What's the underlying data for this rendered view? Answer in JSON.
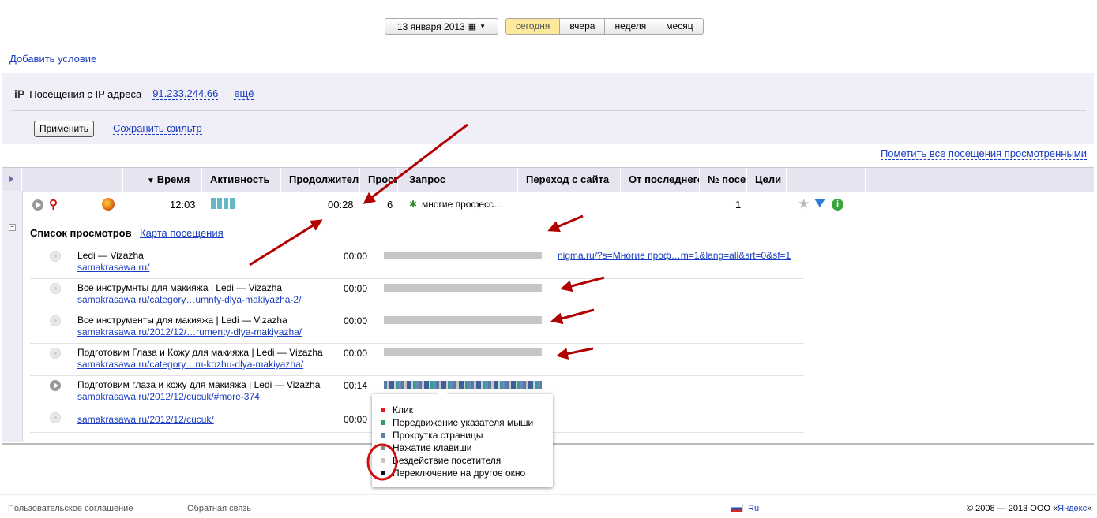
{
  "date_picker": {
    "label": "13 января 2013",
    "icon": "calendar-icon"
  },
  "periods": [
    "сегодня",
    "вчера",
    "неделя",
    "месяц"
  ],
  "add_condition": "Добавить условие",
  "filter": {
    "ip_icon": "iP",
    "label": "Посещения с IP адреса",
    "ip": "91.233.244.66",
    "more": "ещё",
    "apply": "Применить",
    "save": "Сохранить фильтр"
  },
  "mark_all": "Пометить все посещения просмотренными",
  "columns": [
    "Время",
    "Активность",
    "Продолжительность",
    "Просмотры",
    "Запрос",
    "Переход с сайта",
    "От последнего",
    "№ посещения",
    "Цели"
  ],
  "visit": {
    "time": "12:03",
    "duration": "00:28",
    "views": "6",
    "query": "многие професс…",
    "visit_number": "1"
  },
  "views_section": {
    "title": "Список просмотров",
    "map_link": "Карта посещения"
  },
  "pages": [
    {
      "title": "Ledi — Vizazha",
      "url": "samakrasawa.ru/",
      "time": "00:00",
      "referrer": "nigma.ru/?s=Многие проф…m=1&lang=all&srt=0&sf=1"
    },
    {
      "title": "Все инструмнты для макияжа | Ledi — Vizazha",
      "url": "samakrasawa.ru/category…umnty-dlya-makiyazha-2/",
      "time": "00:00",
      "referrer": ""
    },
    {
      "title": "Все инструменты для макияжа | Ledi — Vizazha",
      "url": "samakrasawa.ru/2012/12/…rumenty-dlya-makiyazha/",
      "time": "00:00",
      "referrer": ""
    },
    {
      "title": "Подготовим Глаза и Кожу для макияжа | Ledi — Vizazha",
      "url": "samakrasawa.ru/category…m-kozhu-dlya-makiyazha/",
      "time": "00:00",
      "referrer": ""
    },
    {
      "title": "Подготовим глаза и кожу для макияжа | Ledi — Vizazha",
      "url": "samakrasawa.ru/2012/12/cucuk/#more-374",
      "time": "00:14",
      "referrer": ""
    },
    {
      "title": "",
      "url": "samakrasawa.ru/2012/12/cucuk/",
      "time": "00:00",
      "referrer": ""
    }
  ],
  "legend": [
    {
      "label": "Клик",
      "color": "#e31b1b"
    },
    {
      "label": "Передвижение указателя мыши",
      "color": "#2e9e5c"
    },
    {
      "label": "Прокрутка страницы",
      "color": "#5a7fa8"
    },
    {
      "label": "Нажатие клавиши",
      "color": "#8a8a8a"
    },
    {
      "label": "Бездействие посетителя",
      "color": "#c6c6c6"
    },
    {
      "label": "Переключение на другое окно",
      "color": "#111111"
    }
  ],
  "footer": {
    "agreement": "Пользовательское соглашение",
    "feedback": "Обратная связь",
    "lang": "Ru",
    "copyright_prefix": "© 2008 — 2013 ООО «",
    "company": "Яндекс",
    "copyright_suffix": "»"
  },
  "colors": {
    "accent_link": "#1a3dc1",
    "annotation_arrow": "#b00000",
    "today_bg": "#fde99c"
  }
}
